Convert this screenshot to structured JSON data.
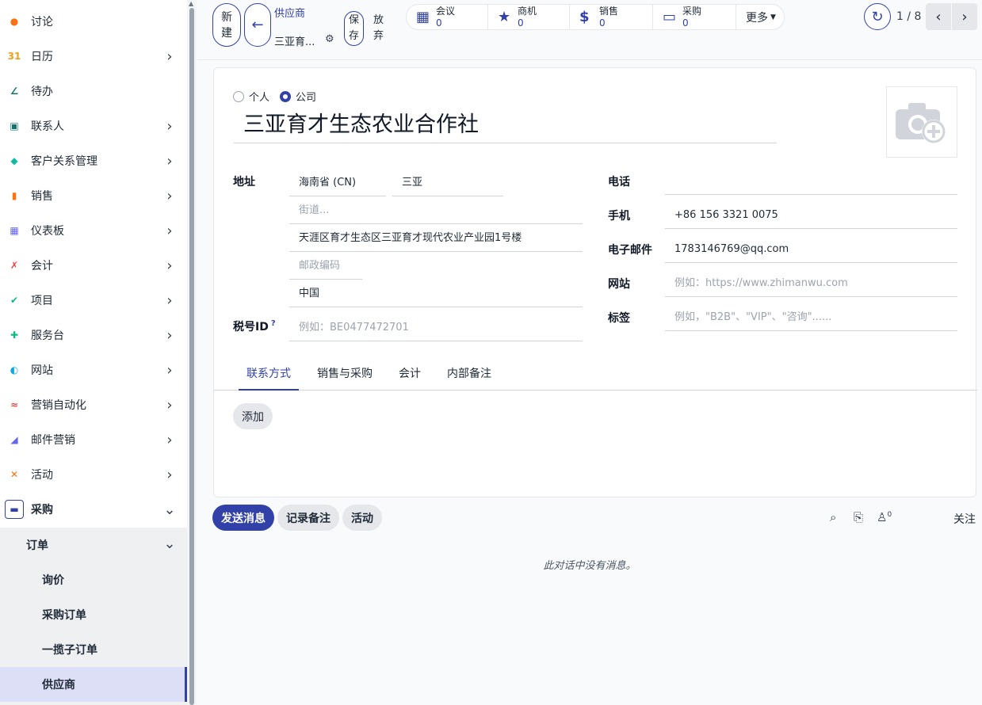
{
  "sidebar": {
    "items": [
      {
        "label": "讨论",
        "icon": "discuss-icon",
        "color": "#f97316",
        "glyph": "●",
        "chevron": false
      },
      {
        "label": "日历",
        "icon": "calendar-icon",
        "color": "#f59e0b",
        "glyph": "31",
        "chevron": true
      },
      {
        "label": "待办",
        "icon": "todo-icon",
        "color": "#0f766e",
        "glyph": "∠",
        "chevron": false
      },
      {
        "label": "联系人",
        "icon": "contacts-icon",
        "color": "#0f766e",
        "glyph": "▣",
        "chevron": true
      },
      {
        "label": "客户关系管理",
        "icon": "crm-icon",
        "color": "#14b8a6",
        "glyph": "◆",
        "chevron": true
      },
      {
        "label": "销售",
        "icon": "sales-icon",
        "color": "#f97316",
        "glyph": "▮",
        "chevron": true
      },
      {
        "label": "仪表板",
        "icon": "dashboard-icon",
        "color": "#6366f1",
        "glyph": "▦",
        "chevron": true
      },
      {
        "label": "会计",
        "icon": "accounting-icon",
        "color": "#ef4444",
        "glyph": "✗",
        "chevron": true
      },
      {
        "label": "项目",
        "icon": "project-icon",
        "color": "#10b981",
        "glyph": "✔",
        "chevron": true
      },
      {
        "label": "服务台",
        "icon": "helpdesk-icon",
        "color": "#10b981",
        "glyph": "✚",
        "chevron": true
      },
      {
        "label": "网站",
        "icon": "website-icon",
        "color": "#0ea5e9",
        "glyph": "◐",
        "chevron": true
      },
      {
        "label": "营销自动化",
        "icon": "marketing-automation-icon",
        "color": "#ef4444",
        "glyph": "≈",
        "chevron": true
      },
      {
        "label": "邮件营销",
        "icon": "email-marketing-icon",
        "color": "#6366f1",
        "glyph": "◢",
        "chevron": true
      },
      {
        "label": "活动",
        "icon": "events-icon",
        "color": "#f97316",
        "glyph": "✕",
        "chevron": true
      },
      {
        "label": "采购",
        "icon": "purchase-icon",
        "color": "#3241a8",
        "glyph": "▬",
        "chevron": true
      }
    ],
    "subgroup": "订单",
    "subitems": [
      "询价",
      "采购订单",
      "一揽子订单",
      "供应商"
    ]
  },
  "toolbar": {
    "new_label_1": "新",
    "new_label_2": "建",
    "breadcrumb": "供应商",
    "record_name": "三亚育...",
    "save_1": "保",
    "save_2": "存",
    "discard_1": "放",
    "discard_2": "弃"
  },
  "smart_buttons": [
    {
      "label": "会议",
      "count": "0",
      "icon": "calendar-icon",
      "glyph": "▦"
    },
    {
      "label": "商机",
      "count": "0",
      "icon": "star-icon",
      "glyph": "★"
    },
    {
      "label": "销售",
      "count": "0",
      "icon": "dollar-icon",
      "glyph": "$"
    },
    {
      "label": "采购",
      "count": "0",
      "icon": "credit-card-icon",
      "glyph": "▭"
    }
  ],
  "more_label": "更多",
  "pager": {
    "value": "1 / 8"
  },
  "form": {
    "type_person": "个人",
    "type_company": "公司",
    "name": "三亚育才生态农业合作社",
    "address_label": "地址",
    "state": "海南省 (CN)",
    "city": "三亚",
    "street_placeholder": "街道...",
    "street2": "天涯区育才生态区三亚育才现代农业产业园1号楼",
    "zip_placeholder": "邮政编码",
    "country": "中国",
    "vat_label": "税号ID",
    "vat_help": "?",
    "vat_placeholder": "例如：BE0477472701",
    "phone_label": "电话",
    "phone": "",
    "mobile_label": "手机",
    "mobile": "+86 156 3321 0075",
    "email_label": "电子邮件",
    "email": "1783146769@qq.com",
    "website_label": "网站",
    "website_placeholder": "例如：https://www.zhimanwu.com",
    "tags_label": "标签",
    "tags_placeholder": "例如，\"B2B\"、\"VIP\"、\"咨询\"......"
  },
  "tabs": [
    "联系方式",
    "销售与采购",
    "会计",
    "内部备注"
  ],
  "add_label": "添加",
  "chatter": {
    "send_message": "发送消息",
    "log_note": "记录备注",
    "activity": "活动",
    "followers_count": "0",
    "follow": "关注",
    "empty": "此对话中没有消息。"
  },
  "colors": {
    "primary": "#3241a8"
  }
}
